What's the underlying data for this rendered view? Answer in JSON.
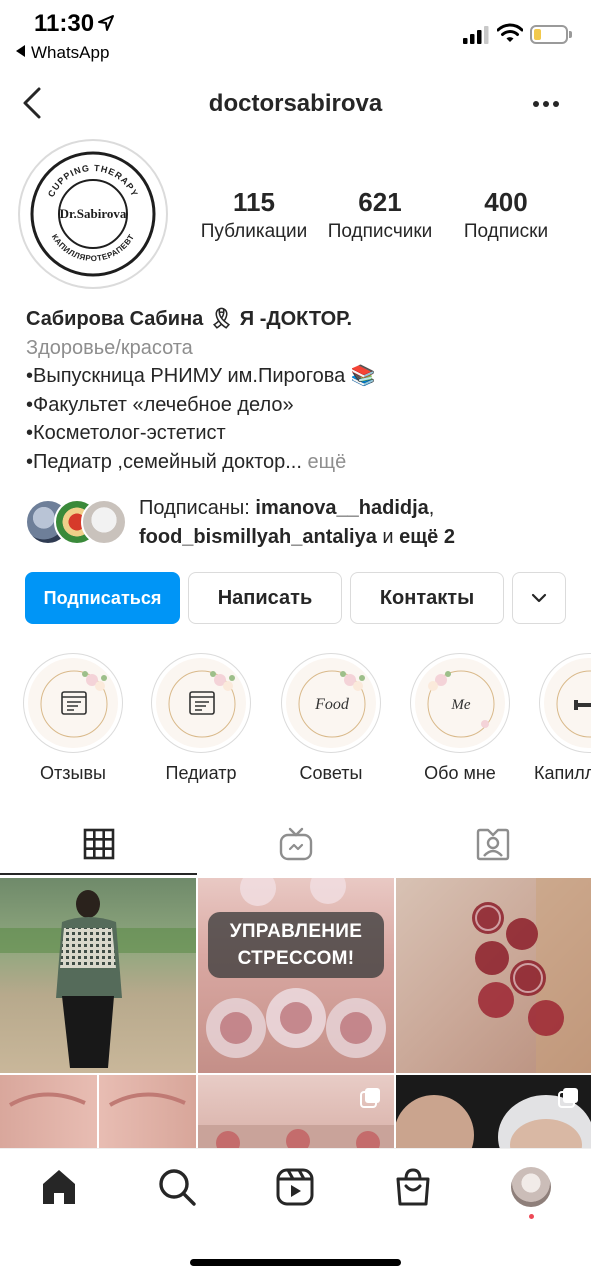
{
  "status_bar": {
    "time": "11:30",
    "back_app": "WhatsApp"
  },
  "header": {
    "username": "doctorsabirova"
  },
  "avatar": {
    "logo_text": "Dr.Sabirova",
    "arc_top": "CUPPING THERAPY",
    "arc_bottom": "КАПИЛЛЯРОТЕРАПЕВТ"
  },
  "stats": {
    "posts": {
      "value": "115",
      "label": "Публикации"
    },
    "followers": {
      "value": "621",
      "label": "Подписчики"
    },
    "following": {
      "value": "400",
      "label": "Подписки"
    }
  },
  "bio": {
    "name": "Сабирова Сабина",
    "name_emoji": "🎗",
    "name_suffix": " Я -ДОКТОР.",
    "category": "Здоровье/красота",
    "lines": [
      "•Выпускница РНИМУ им.Пирогова 📚",
      "•Факультет «лечебное дело»",
      "•Косметолог-эстетист",
      "•Педиатр ,семейный доктор..."
    ],
    "more": "ещё"
  },
  "followed_by": {
    "prefix": "Подписаны: ",
    "user1": "imanova__hadidja",
    "separator": ",",
    "user2": "food_bismillyah_antaliya",
    "middle": " и ",
    "suffix": "ещё 2"
  },
  "buttons": {
    "follow": "Подписаться",
    "message": "Написать",
    "contacts": "Контакты"
  },
  "highlights": [
    {
      "label": "Отзывы",
      "inner": ""
    },
    {
      "label": "Педиатр",
      "inner": ""
    },
    {
      "label": "Советы",
      "inner": "Food"
    },
    {
      "label": "Обо мне",
      "inner": "Me"
    },
    {
      "label": "Капилл",
      "inner": ""
    }
  ],
  "grid": {
    "post2_text": "УПРАВЛЕНИЕ СТРЕССОМ!"
  },
  "colors": {
    "accent": "#0095f6",
    "text": "#262626",
    "secondary": "#8e8e8e",
    "border": "#dbdbdb"
  },
  "icons": {
    "tabs": [
      "grid-icon",
      "igtv-icon",
      "tagged-icon"
    ],
    "nav": [
      "home-icon",
      "search-icon",
      "reels-icon",
      "shop-icon",
      "profile-icon"
    ]
  }
}
